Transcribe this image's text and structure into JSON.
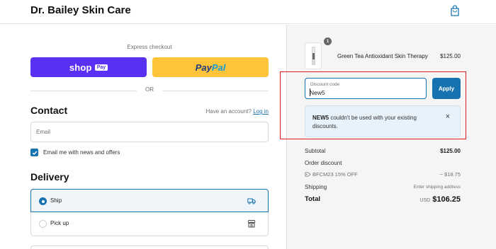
{
  "header": {
    "brand": "Dr. Bailey Skin Care",
    "cart_icon": "shopping-bag-icon"
  },
  "checkout": {
    "express_label": "Express checkout",
    "shop_pay": {
      "word": "shop",
      "badge": "Pay"
    },
    "paypal": {
      "part1": "Pay",
      "part2": "Pal"
    },
    "or_text": "OR",
    "contact": {
      "title": "Contact",
      "have_account": "Have an account?",
      "login": "Log in",
      "email_placeholder": "Email",
      "newsletter_label": "Email me with news and offers",
      "newsletter_checked": true
    },
    "delivery": {
      "title": "Delivery",
      "options": [
        {
          "label": "Ship",
          "selected": true,
          "icon": "truck-icon"
        },
        {
          "label": "Pick up",
          "selected": false,
          "icon": "store-icon"
        }
      ]
    }
  },
  "summary": {
    "item": {
      "name": "Green Tea Antioxidant Skin Therapy",
      "price": "$125.00",
      "quantity": "1"
    },
    "discount": {
      "label": "Discount code",
      "value": "New5",
      "apply": "Apply"
    },
    "alert": {
      "code": "NEW5",
      "message": " couldn't be used with your existing discounts.",
      "close": "×"
    },
    "subtotal": {
      "label": "Subtotal",
      "value": "$125.00"
    },
    "order_discount": {
      "label": "Order discount"
    },
    "discount_line": {
      "code": "BFCM23 15% OFF",
      "value": "− $18.75"
    },
    "shipping": {
      "label": "Shipping",
      "value": "Enter shipping address"
    },
    "total": {
      "label": "Total",
      "currency": "USD",
      "value": "$106.25"
    }
  },
  "colors": {
    "accent": "#1773b0",
    "shop_pay": "#5a31f4",
    "paypal": "#ffc439",
    "highlight": "#e0191d"
  }
}
